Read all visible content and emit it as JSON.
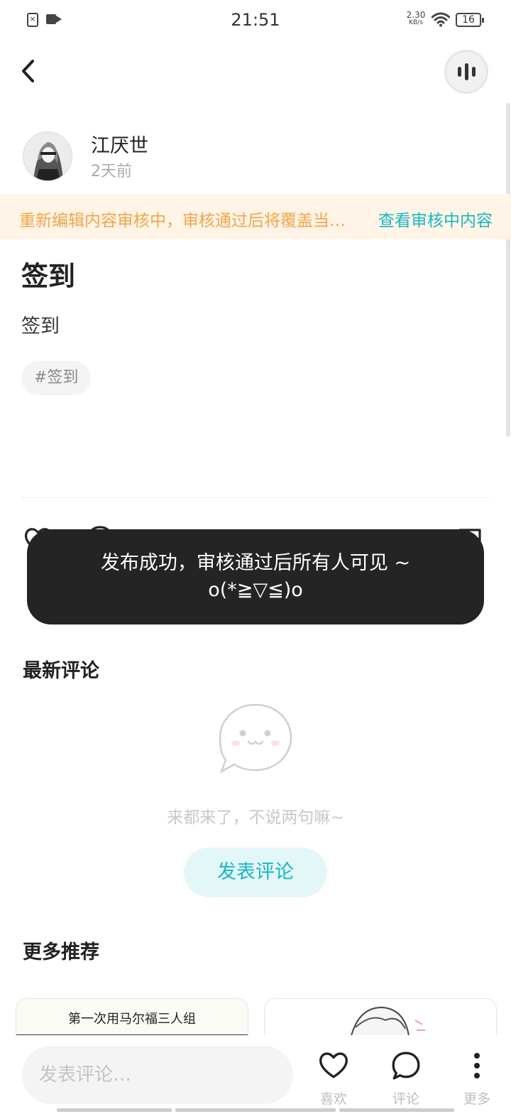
{
  "status_bar": {
    "time": "21:51",
    "net_speed": "2.30",
    "net_unit": "KB/s",
    "battery": "16"
  },
  "post": {
    "author": "江厌世",
    "time_ago": "2天前",
    "review_notice": "重新编辑内容审核中，审核通过后将覆盖当…",
    "review_link": "查看审核中内容",
    "title": "签到",
    "body": "签到",
    "tag": "#签到"
  },
  "toast": {
    "line1": "发布成功，审核通过后所有人可见 ~",
    "line2": "o(*≧▽≦)o"
  },
  "comments": {
    "section_title": "最新评论",
    "empty_text": "来都来了，不说两句嘛~",
    "post_button": "发表评论"
  },
  "recommend": {
    "section_title": "更多推荐",
    "card1_caption": "第一次用马尔福三人组"
  },
  "bottom_bar": {
    "input_placeholder": "发表评论…",
    "like_label": "喜欢",
    "comment_label": "评论",
    "more_label": "更多"
  },
  "colors": {
    "accent": "#19b6c4",
    "notice_text": "#f0a54a",
    "notice_bg": "#fff4e6",
    "toast_bg": "#242424"
  }
}
